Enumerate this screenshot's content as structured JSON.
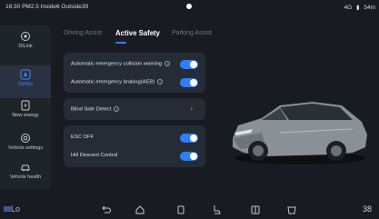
{
  "status": {
    "left_text": "16:30 PM2.5 Inside6 Outside39",
    "network": "4G",
    "signal": "▮",
    "range": "54m"
  },
  "sidebar": {
    "items": [
      {
        "label": "DiLink",
        "icon": "dilink-icon"
      },
      {
        "label": "DiPilot",
        "icon": "dipilot-icon",
        "active": true
      },
      {
        "label": "New energy",
        "icon": "new-energy-icon"
      },
      {
        "label": "Vehicle settings",
        "icon": "vehicle-settings-icon"
      },
      {
        "label": "Vehicle health",
        "icon": "vehicle-health-icon"
      }
    ]
  },
  "tabs": [
    {
      "label": "Driving Assist"
    },
    {
      "label": "Active Safety",
      "active": true
    },
    {
      "label": "Parking Assist"
    }
  ],
  "settings": {
    "aeb_warning": {
      "label": "Automatic emergency collision warning",
      "enabled": true
    },
    "aeb_braking": {
      "label": "Automatic emergency braking(AEB)",
      "enabled": true
    },
    "blind_side": {
      "label": "Blind Side Detect"
    },
    "esc_off": {
      "label": "ESC OFF",
      "enabled": true
    },
    "hill_descent": {
      "label": "Hill Descent Control",
      "enabled": true
    }
  },
  "bottom": {
    "left_temp": "Lo",
    "right_temp": "38"
  },
  "colors": {
    "accent": "#2b7fff",
    "background": "#181c22",
    "card": "#262c35"
  }
}
